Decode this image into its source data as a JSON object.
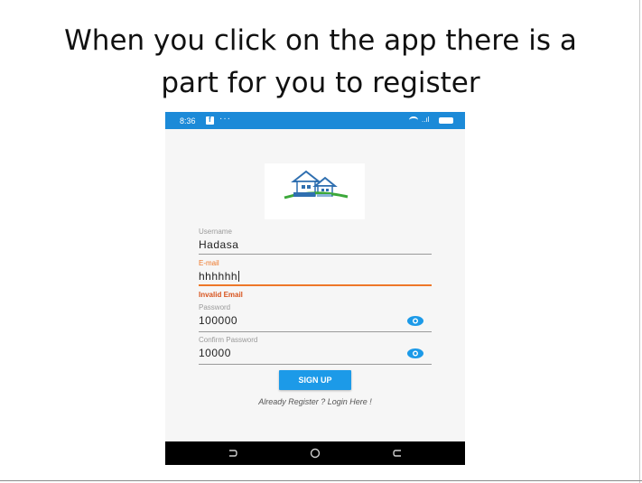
{
  "slide": {
    "title_line1": "When you click on the app there is a",
    "title_line2": "part for you to register"
  },
  "status_bar": {
    "time": "8:36",
    "fb_glyph": "f",
    "dots": "···",
    "signal": "..ıl",
    "color": "#1c8ad8"
  },
  "form": {
    "username": {
      "label": "Username",
      "value": "Hadasa"
    },
    "email": {
      "label": "E-mail",
      "value": "hhhhhh",
      "error": "Invalid Email",
      "error_color": "#ee7728"
    },
    "password": {
      "label": "Password",
      "value": "100000",
      "icon": "eye-icon"
    },
    "confirm_password": {
      "label": "Confirm Password",
      "value": "10000",
      "icon": "eye-icon"
    },
    "signup_label": "SIGN UP",
    "login_link": "Already Register ? Login Here !",
    "accent_color": "#1c9ae8"
  },
  "nav_bar": {
    "icons": [
      "back-icon",
      "home-icon",
      "recents-icon"
    ]
  }
}
